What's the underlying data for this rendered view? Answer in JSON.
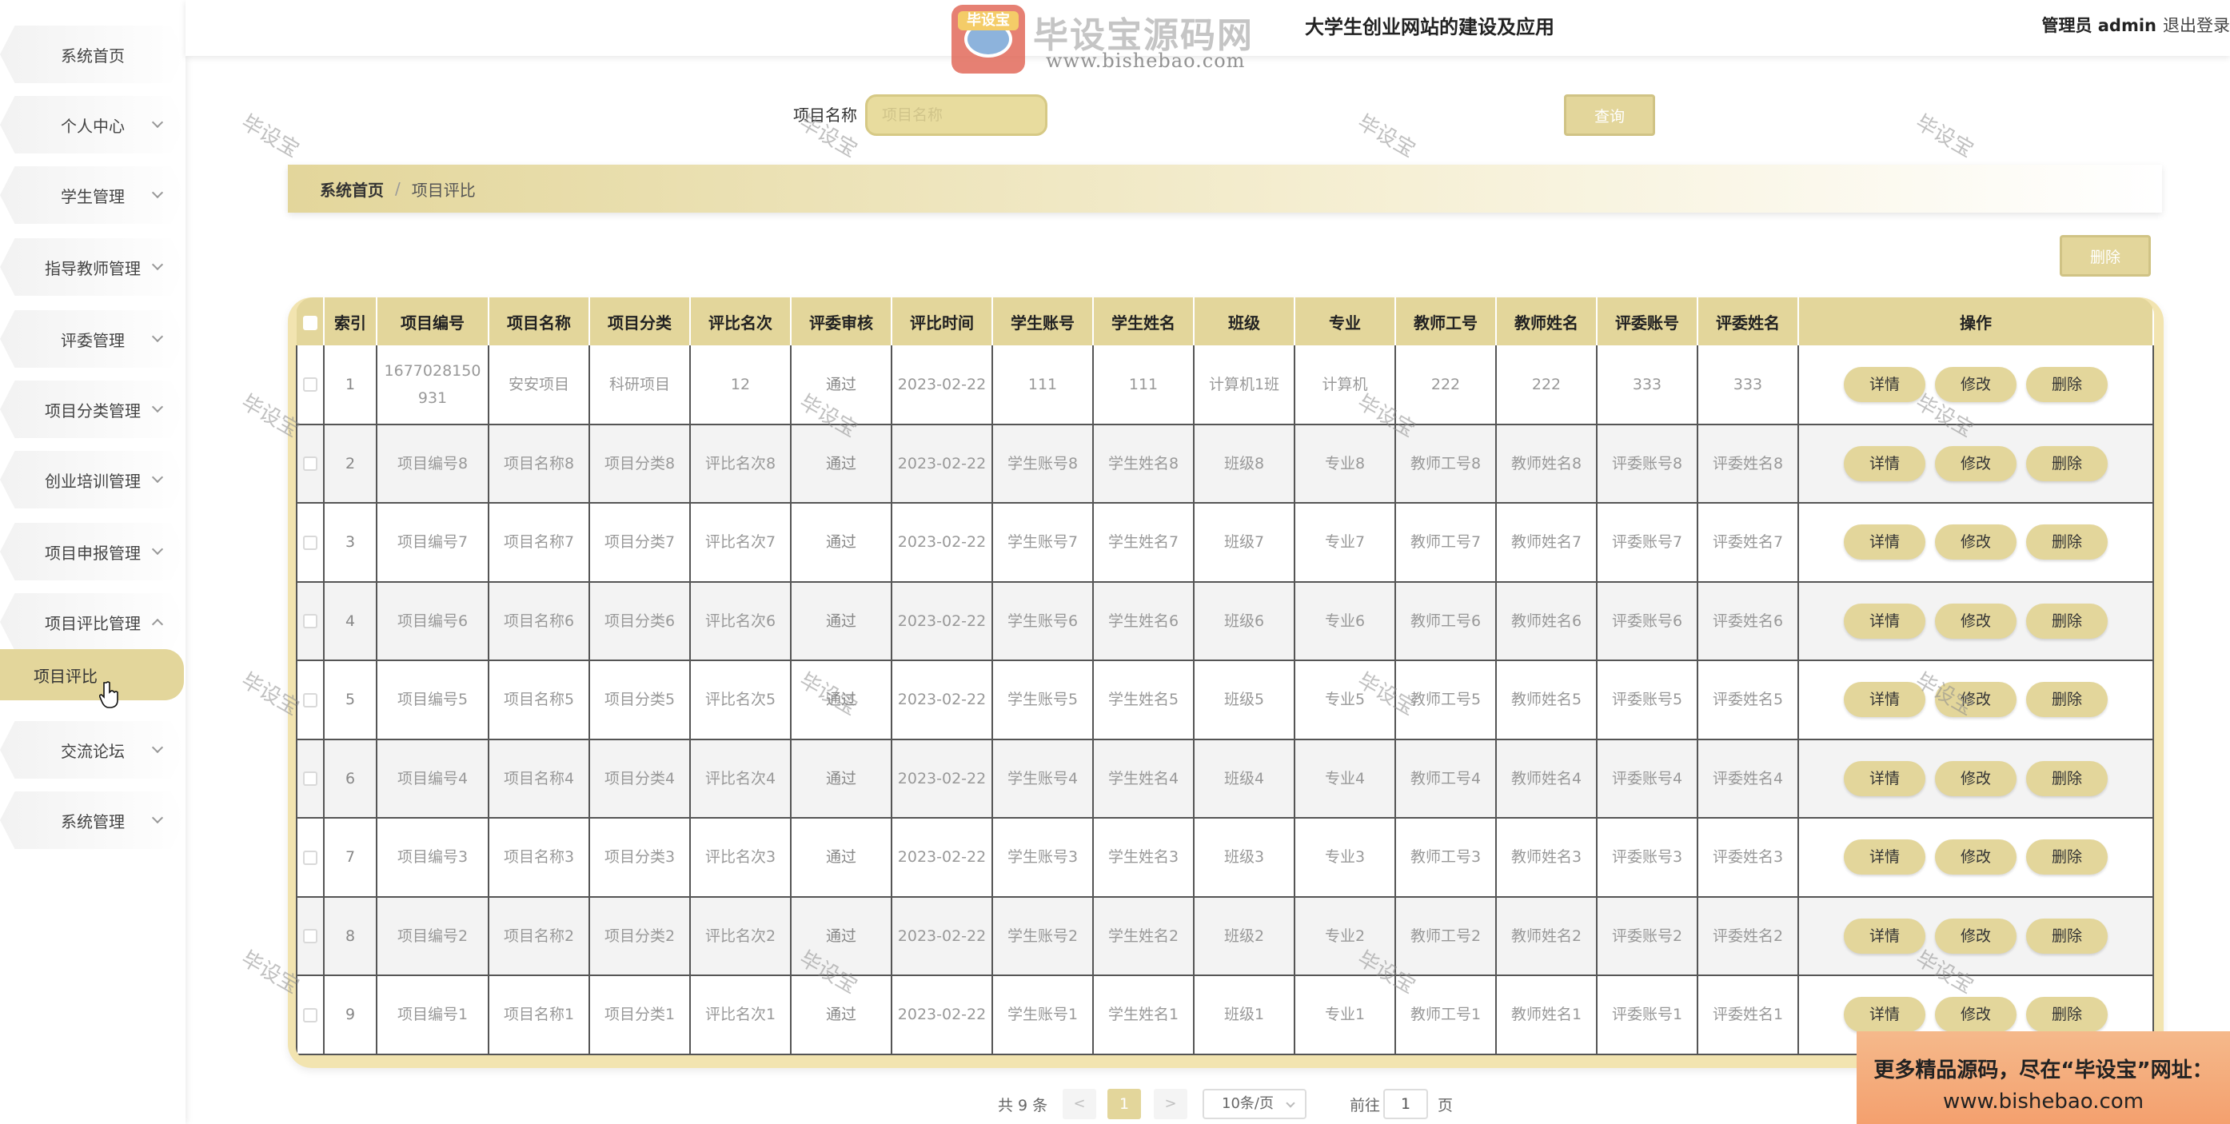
{
  "sidebar": {
    "items": [
      {
        "label": "系统首页",
        "has_chevron": false
      },
      {
        "label": "个人中心",
        "has_chevron": true
      },
      {
        "label": "学生管理",
        "has_chevron": true
      },
      {
        "label": "指导教师管理",
        "has_chevron": true
      },
      {
        "label": "评委管理",
        "has_chevron": true
      },
      {
        "label": "项目分类管理",
        "has_chevron": true
      },
      {
        "label": "创业培训管理",
        "has_chevron": true
      },
      {
        "label": "项目申报管理",
        "has_chevron": true
      },
      {
        "label": "项目评比管理",
        "has_chevron": true,
        "expanded": true
      },
      {
        "label": "项目评比",
        "has_chevron": false,
        "active": true
      },
      {
        "label": "交流论坛",
        "has_chevron": true
      },
      {
        "label": "系统管理",
        "has_chevron": true
      }
    ]
  },
  "header": {
    "title": "大学生创业网站的建设及应用",
    "admin_label": "管理员 admin",
    "logout_label": "退出登录"
  },
  "watermark": {
    "logo_tag": "毕设宝",
    "brand": "毕设宝源码网",
    "url": "www.bishebao.com",
    "diagonal_text": "毕设宝"
  },
  "search": {
    "label": "项目名称",
    "placeholder": "项目名称",
    "button_label": "查询"
  },
  "breadcrumb": {
    "home": "系统首页",
    "separator": "/",
    "current": "项目评比"
  },
  "toolbar": {
    "delete_label": "删除"
  },
  "table": {
    "columns": [
      "索引",
      "项目编号",
      "项目名称",
      "项目分类",
      "评比名次",
      "评委审核",
      "评比时间",
      "学生账号",
      "学生姓名",
      "班级",
      "专业",
      "教师工号",
      "教师姓名",
      "评委账号",
      "评委姓名",
      "操作"
    ],
    "rows": [
      [
        "1",
        "1677028150931",
        "安安项目",
        "科研项目",
        "12",
        "通过",
        "2023-02-22",
        "111",
        "111",
        "计算机1班",
        "计算机",
        "222",
        "222",
        "333",
        "333"
      ],
      [
        "2",
        "项目编号8",
        "项目名称8",
        "项目分类8",
        "评比名次8",
        "通过",
        "2023-02-22",
        "学生账号8",
        "学生姓名8",
        "班级8",
        "专业8",
        "教师工号8",
        "教师姓名8",
        "评委账号8",
        "评委姓名8"
      ],
      [
        "3",
        "项目编号7",
        "项目名称7",
        "项目分类7",
        "评比名次7",
        "通过",
        "2023-02-22",
        "学生账号7",
        "学生姓名7",
        "班级7",
        "专业7",
        "教师工号7",
        "教师姓名7",
        "评委账号7",
        "评委姓名7"
      ],
      [
        "4",
        "项目编号6",
        "项目名称6",
        "项目分类6",
        "评比名次6",
        "通过",
        "2023-02-22",
        "学生账号6",
        "学生姓名6",
        "班级6",
        "专业6",
        "教师工号6",
        "教师姓名6",
        "评委账号6",
        "评委姓名6"
      ],
      [
        "5",
        "项目编号5",
        "项目名称5",
        "项目分类5",
        "评比名次5",
        "通过",
        "2023-02-22",
        "学生账号5",
        "学生姓名5",
        "班级5",
        "专业5",
        "教师工号5",
        "教师姓名5",
        "评委账号5",
        "评委姓名5"
      ],
      [
        "6",
        "项目编号4",
        "项目名称4",
        "项目分类4",
        "评比名次4",
        "通过",
        "2023-02-22",
        "学生账号4",
        "学生姓名4",
        "班级4",
        "专业4",
        "教师工号4",
        "教师姓名4",
        "评委账号4",
        "评委姓名4"
      ],
      [
        "7",
        "项目编号3",
        "项目名称3",
        "项目分类3",
        "评比名次3",
        "通过",
        "2023-02-22",
        "学生账号3",
        "学生姓名3",
        "班级3",
        "专业3",
        "教师工号3",
        "教师姓名3",
        "评委账号3",
        "评委姓名3"
      ],
      [
        "8",
        "项目编号2",
        "项目名称2",
        "项目分类2",
        "评比名次2",
        "通过",
        "2023-02-22",
        "学生账号2",
        "学生姓名2",
        "班级2",
        "专业2",
        "教师工号2",
        "教师姓名2",
        "评委账号2",
        "评委姓名2"
      ],
      [
        "9",
        "项目编号1",
        "项目名称1",
        "项目分类1",
        "评比名次1",
        "通过",
        "2023-02-22",
        "学生账号1",
        "学生姓名1",
        "班级1",
        "专业1",
        "教师工号1",
        "教师姓名1",
        "评委账号1",
        "评委姓名1"
      ]
    ],
    "actions": [
      "详情",
      "修改",
      "删除"
    ]
  },
  "pagination": {
    "total_label": "共 9 条",
    "prev": "<",
    "next": ">",
    "current_page": "1",
    "page_size_label": "10条/页",
    "goto_prefix": "前往",
    "goto_value": "1",
    "goto_suffix": "页"
  },
  "promo": {
    "line1": "更多精品源码，尽在“毕设宝”网址：",
    "line2": "www.bishebao.com"
  },
  "colors": {
    "accent": "#e3d69b",
    "accent_border": "#d0c385",
    "table_frame": "#f2e4b0",
    "promo_bg": "#f4a06e"
  }
}
